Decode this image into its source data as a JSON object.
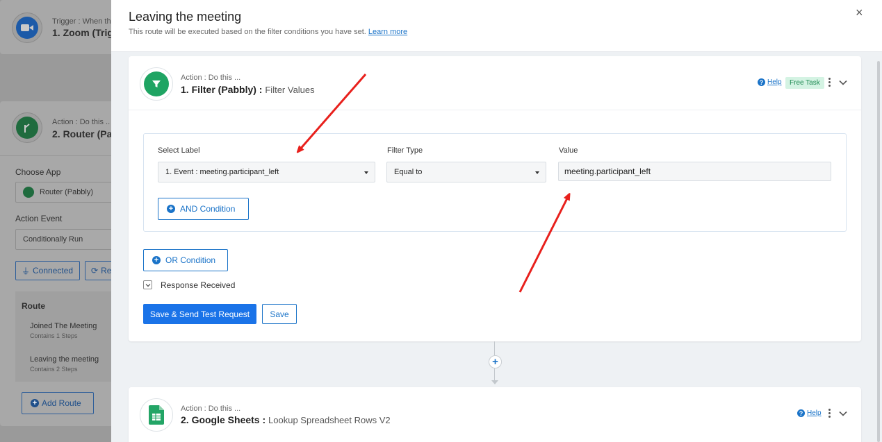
{
  "background": {
    "trigger": {
      "sub": "Trigger : When th",
      "title": "1. Zoom (Trig"
    },
    "router": {
      "sub": "Action : Do this ..",
      "title": "2. Router (Pa",
      "choose_app_label": "Choose App",
      "choose_app_value": "Router (Pabbly)",
      "action_event_label": "Action Event",
      "action_event_value": "Conditionally Run",
      "connected_label": "Connected",
      "reconnect_label": "Re",
      "route_heading": "Route",
      "routes": [
        {
          "name": "Joined The Meeting",
          "steps": "Contains 1 Steps"
        },
        {
          "name": "Leaving the meeting",
          "steps": "Contains 2 Steps"
        }
      ],
      "add_route_label": "Add Route"
    }
  },
  "modal": {
    "title": "Leaving the meeting",
    "subtitle": "This route will be executed based on the filter conditions you have set.",
    "learn_more": "Learn more",
    "close": "×"
  },
  "step1": {
    "sub": "Action : Do this ...",
    "app": "1. Filter (Pabbly) :",
    "event": "Filter Values",
    "help": "Help",
    "badge": "Free Task",
    "filter": {
      "select_label_heading": "Select Label",
      "select_label_value": "1. Event : meeting.participant_left",
      "filter_type_heading": "Filter Type",
      "filter_type_value": "Equal to",
      "value_heading": "Value",
      "value_value": "meeting.participant_left",
      "and_condition": "AND Condition"
    },
    "or_condition": "OR Condition",
    "response_received": "Response Received",
    "save_send": "Save & Send Test Request",
    "save": "Save"
  },
  "step2": {
    "sub": "Action : Do this ...",
    "app": "2. Google Sheets :",
    "event": "Lookup Spreadsheet Rows V2",
    "help": "Help"
  },
  "colors": {
    "primary": "#1a73e8",
    "filter_green": "#1fa463",
    "sheets_green": "#23a566",
    "zoom_blue": "#2d8cff",
    "annotation_red": "#e8201c"
  }
}
